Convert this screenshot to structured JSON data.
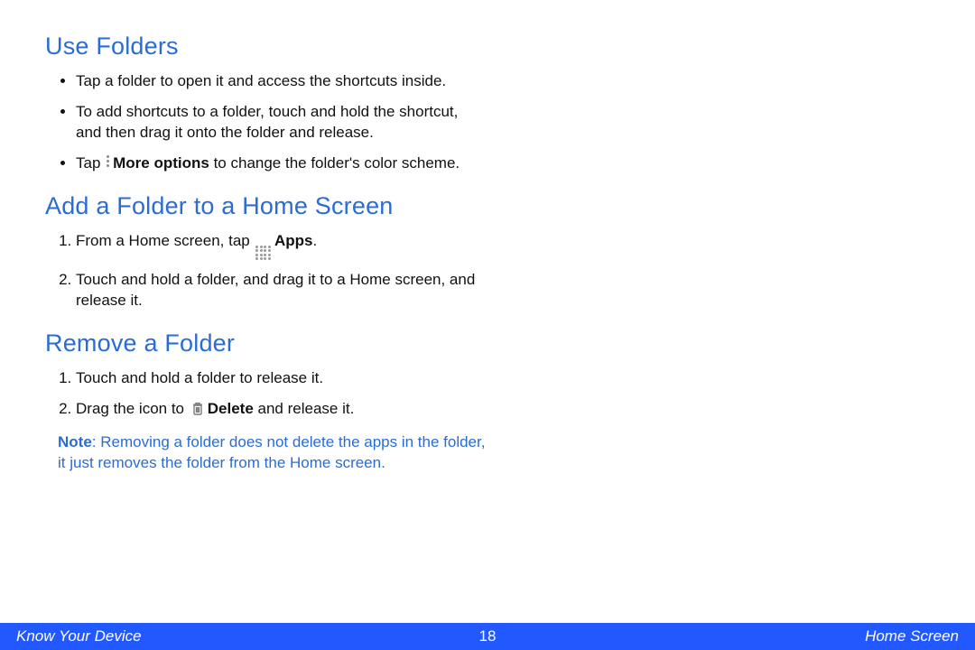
{
  "sections": {
    "use_folders": {
      "heading": "Use Folders",
      "bullets": {
        "b1": "Tap a folder to open it and access the shortcuts inside.",
        "b2": "To add shortcuts to a folder, touch and hold the shortcut, and then drag it onto the folder and release.",
        "b3_pre": "Tap ",
        "b3_bold": "More options",
        "b3_post": " to change the folder's color scheme."
      }
    },
    "add_folder": {
      "heading": "Add a Folder to a Home Screen",
      "steps": {
        "s1_pre": "From a Home screen, tap ",
        "s1_bold": "Apps",
        "s1_post": ".",
        "s2": "Touch and hold a folder, and drag it to a Home screen, and release it."
      }
    },
    "remove_folder": {
      "heading": "Remove a Folder",
      "steps": {
        "s1": "Touch and hold a folder to release it.",
        "s2_pre": "Drag the icon to ",
        "s2_bold": "Delete",
        "s2_post": " and release it."
      },
      "note": {
        "label": "Note",
        "sep": ": ",
        "text": "Removing a folder does not delete the apps in the folder, it just removes the folder from the Home screen."
      }
    }
  },
  "footer": {
    "left": "Know Your Device",
    "page": "18",
    "right": "Home Screen"
  }
}
